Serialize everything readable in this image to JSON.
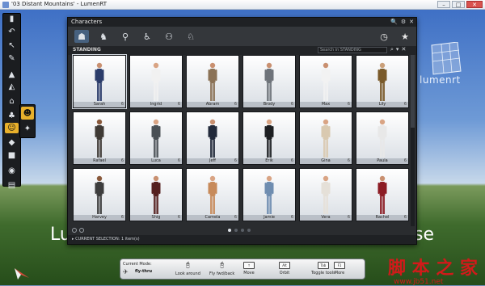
{
  "window": {
    "title": "'03 Distant Mountains' - LumenRT",
    "min": "–",
    "max": "□",
    "close": "✕"
  },
  "brand": {
    "logo_text": "lumenrt"
  },
  "background": {
    "left_text": "Lu",
    "right_text": "se"
  },
  "watermark": {
    "text": "脚 本 之 家",
    "url": "www.jb51.net"
  },
  "left_toolbar": {
    "items": [
      {
        "icon": "book-icon",
        "glyph": "▮"
      },
      {
        "icon": "undo-icon",
        "glyph": "↶"
      },
      {
        "icon": "pointer-icon",
        "glyph": "↖"
      },
      {
        "icon": "brush-icon",
        "glyph": "✎"
      },
      {
        "icon": "terrain-icon",
        "glyph": "▲"
      },
      {
        "icon": "mountain-icon",
        "glyph": "◭"
      },
      {
        "icon": "landscape-icon",
        "glyph": "⌂"
      },
      {
        "icon": "plant-icon",
        "glyph": "♣"
      },
      {
        "icon": "characters-icon",
        "glyph": "☺",
        "active": true
      },
      {
        "icon": "vehicle-icon",
        "glyph": "◆"
      },
      {
        "icon": "object-icon",
        "glyph": "■"
      },
      {
        "icon": "camera-icon",
        "glyph": "◉"
      },
      {
        "icon": "video-icon",
        "glyph": "▤"
      }
    ],
    "sub_items": [
      {
        "icon": "person-add-icon",
        "glyph": "☻",
        "active": true
      },
      {
        "icon": "wand-icon",
        "glyph": "✦"
      }
    ]
  },
  "panel": {
    "title": "Characters",
    "controls": [
      "🔍",
      "⚙",
      "✕"
    ],
    "category_tabs": [
      {
        "icon": "standing-icon",
        "glyph": "☗",
        "active": true
      },
      {
        "icon": "sitting-icon",
        "glyph": "♞"
      },
      {
        "icon": "walking-icon",
        "glyph": "⚲"
      },
      {
        "icon": "wheelchair-icon",
        "glyph": "♿"
      },
      {
        "icon": "group-icon",
        "glyph": "⚇"
      },
      {
        "icon": "animal-icon",
        "glyph": "♘"
      }
    ],
    "recent_icon": "◷",
    "favorites_icon": "★",
    "section_label": "STANDING",
    "search_placeholder": "Search in STANDING",
    "search_icons": [
      "⌕",
      "▾",
      "✕"
    ],
    "characters": [
      {
        "name": "Sarah",
        "count": "6",
        "tone": "#2b3c6a",
        "skin": "#c99070"
      },
      {
        "name": "Ingrid",
        "count": "6",
        "tone": "#f1f1f1",
        "skin": "#d9a484"
      },
      {
        "name": "Abram",
        "count": "6",
        "tone": "#8b7256",
        "skin": "#c99070"
      },
      {
        "name": "Brody",
        "count": "6",
        "tone": "#6e737a",
        "skin": "#c99070"
      },
      {
        "name": "Max",
        "count": "6",
        "tone": "#f2f2f2",
        "skin": "#c99070"
      },
      {
        "name": "Lily",
        "count": "6",
        "tone": "#7a5a2a",
        "skin": "#caa07a"
      },
      {
        "name": "Rafael",
        "count": "6",
        "tone": "#3f3a35",
        "skin": "#8a5a3c"
      },
      {
        "name": "Luca",
        "count": "6",
        "tone": "#4a5055",
        "skin": "#d9a484"
      },
      {
        "name": "Jeff",
        "count": "6",
        "tone": "#222a3b",
        "skin": "#c99070"
      },
      {
        "name": "Erik",
        "count": "6",
        "tone": "#1d1f22",
        "skin": "#d9a484"
      },
      {
        "name": "Gina",
        "count": "6",
        "tone": "#d9c9b0",
        "skin": "#d9a484"
      },
      {
        "name": "Paula",
        "count": "6",
        "tone": "#e8e8e8",
        "skin": "#d9a484"
      },
      {
        "name": "Harvey",
        "count": "6",
        "tone": "#3d3d3d",
        "skin": "#8a5a3c"
      },
      {
        "name": "Shig",
        "count": "6",
        "tone": "#55201f",
        "skin": "#c99070"
      },
      {
        "name": "Camela",
        "count": "6",
        "tone": "#c78a5a",
        "skin": "#d9a484"
      },
      {
        "name": "Jamie",
        "count": "6",
        "tone": "#6f8db0",
        "skin": "#d9a484"
      },
      {
        "name": "Vera",
        "count": "6",
        "tone": "#e5e0d8",
        "skin": "#d9a484"
      },
      {
        "name": "Rachel",
        "count": "6",
        "tone": "#8c1c24",
        "skin": "#c99070"
      }
    ],
    "footer_text": "▸ CURRENT SELECTION: 1 item(s)"
  },
  "nav": {
    "current_mode_label": "Current Mode:",
    "current_mode_value": "fly-thru",
    "items": [
      {
        "icon": "mouse-left-icon",
        "key": "",
        "label": "Look around"
      },
      {
        "icon": "mouse-right-icon",
        "key": "",
        "label": "Fly fwd/back"
      },
      {
        "icon": "move-icon",
        "key": "↑",
        "label": "Move"
      },
      {
        "icon": "orbit-icon",
        "key": "Alt",
        "label": "Orbit"
      },
      {
        "icon": "toggle-icon",
        "key": "Tab",
        "label": "Toggle tools"
      },
      {
        "icon": "more-icon",
        "key": "F1",
        "label": "More"
      }
    ]
  }
}
